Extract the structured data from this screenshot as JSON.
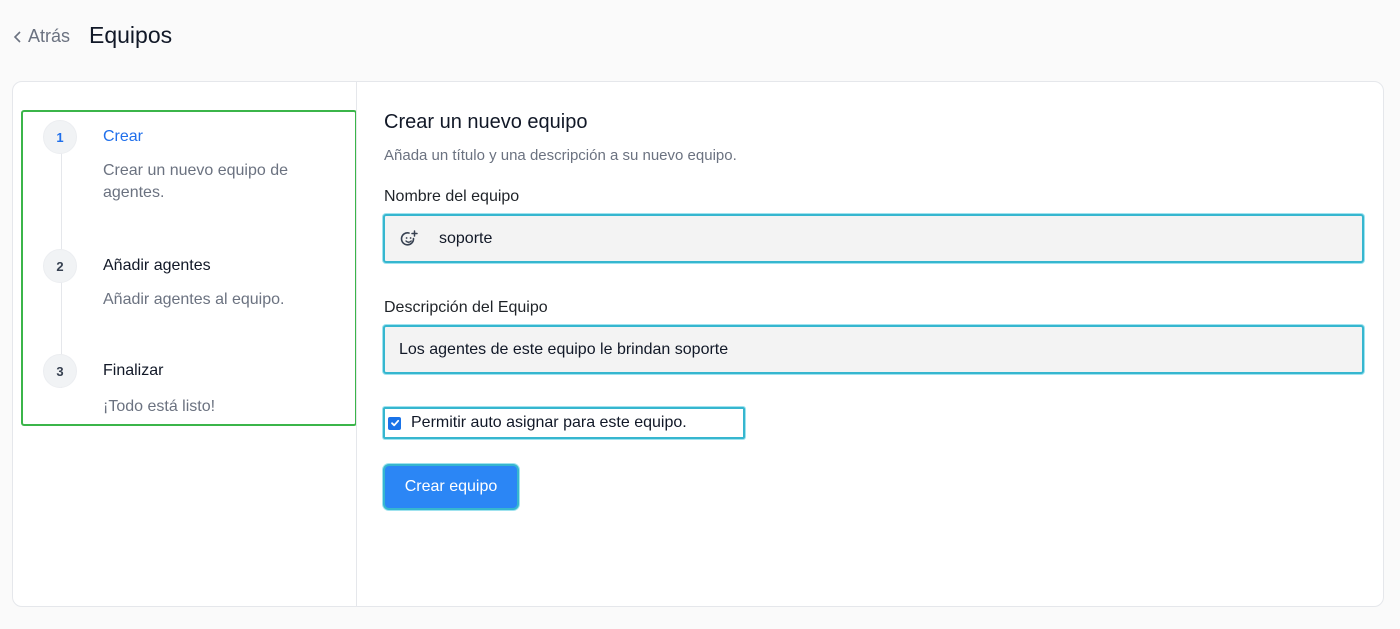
{
  "header": {
    "back_label": "Atrás",
    "title": "Equipos"
  },
  "steps": [
    {
      "number": "1",
      "title": "Crear",
      "description": "Crear un nuevo equipo de agentes.",
      "active": true
    },
    {
      "number": "2",
      "title": "Añadir agentes",
      "description": "Añadir agentes al equipo.",
      "active": false
    },
    {
      "number": "3",
      "title": "Finalizar",
      "description": "¡Todo está listo!",
      "active": false
    }
  ],
  "form": {
    "title": "Crear un nuevo equipo",
    "subtitle": "Añada un título y una descripción a su nuevo equipo.",
    "name_label": "Nombre del equipo",
    "name_value": "soporte",
    "name_icon": "emoji-add-icon",
    "description_label": "Descripción del Equipo",
    "description_value": "Los agentes de este equipo le brindan soporte",
    "auto_assign_label": "Permitir auto asignar para este equipo.",
    "auto_assign_checked": true,
    "submit_label": "Crear equipo"
  },
  "colors": {
    "accent": "#1f6feb",
    "button": "#2b86f5",
    "focus_ring": "#36b6cf",
    "steps_outline": "#3bb54a"
  }
}
